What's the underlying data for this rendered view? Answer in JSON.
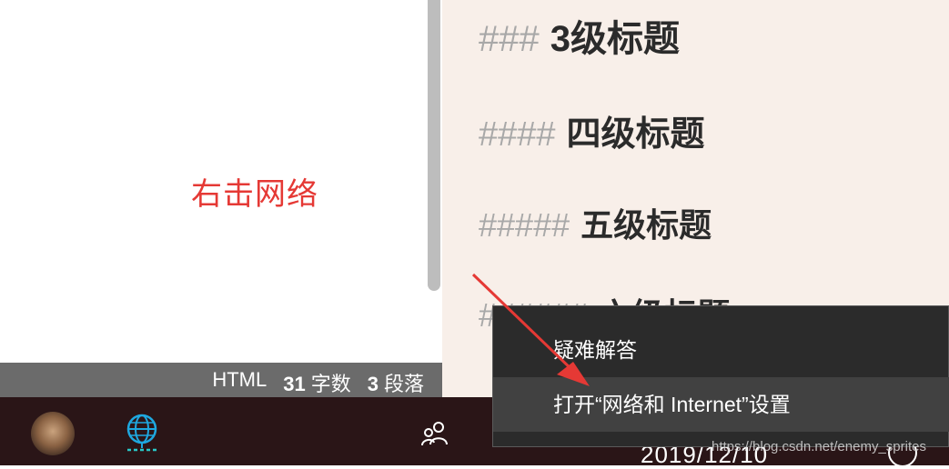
{
  "left_pane": {
    "note": "右击网络"
  },
  "status_bar": {
    "mode": "HTML",
    "word_count": "31",
    "word_label": "字数",
    "para_count": "3",
    "para_label": "段落"
  },
  "preview": {
    "headings": [
      {
        "hashes": "###",
        "text": "3级标题"
      },
      {
        "hashes": "####",
        "text": "四级标题"
      },
      {
        "hashes": "#####",
        "text": "五级标题"
      },
      {
        "hashes": "######",
        "text": "六级标题"
      }
    ]
  },
  "context_menu": {
    "items": [
      {
        "label": "疑难解答"
      },
      {
        "label": "打开“网络和 Internet”设置"
      }
    ]
  },
  "taskbar": {
    "date": "2019/12/10",
    "icons": [
      "avatar",
      "globe-network-icon",
      "people-icon",
      "notification-icon"
    ]
  },
  "watermark": "https://blog.csdn.net/enemy_sprites",
  "colors": {
    "annotation": "#e53935",
    "arrow": "#e53935",
    "menu_bg": "#2b2b2b",
    "menu_highlight": "#414141",
    "taskbar_bg": "#2a1517",
    "preview_bg": "#f8efe9",
    "status_bar_bg": "#6b6b6b"
  }
}
